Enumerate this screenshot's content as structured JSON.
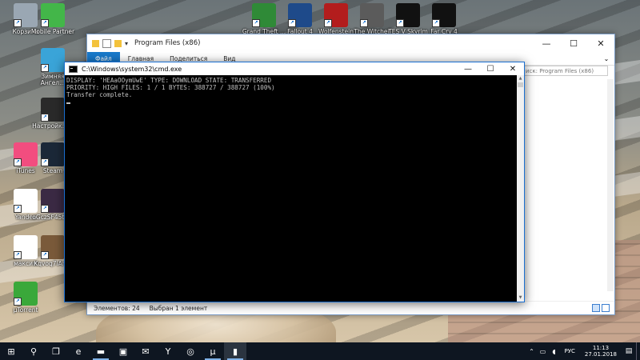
{
  "desktop": {
    "left_icons": [
      {
        "label": "Корзина",
        "icon": "recycle-bin-icon",
        "color": "#9aa7b3"
      },
      {
        "label": "Mobile Partner",
        "icon": "mobile-partner-icon",
        "color": "#43b649"
      },
      {
        "label": "Зимняя Ангел...",
        "icon": "arrow-shortcut-icon",
        "color": "#3aa4d8"
      },
      {
        "label": "Настройк... 4",
        "icon": "settings-gear-icon",
        "color": "#2a2a2a"
      },
      {
        "label": "iTunes",
        "icon": "itunes-icon",
        "color": "#f24d7f"
      },
      {
        "label": "Steam",
        "icon": "steam-icon",
        "color": "#1b2838"
      },
      {
        "label": "Yandex",
        "icon": "yandex-icon",
        "color": "#ffffff"
      },
      {
        "label": "oGczSF45tV...",
        "icon": "photo-thumbnail-icon",
        "color": "#3b2a44"
      },
      {
        "label": "максим",
        "icon": "document-icon",
        "color": "#ffffff"
      },
      {
        "label": "Kqvoq7iAn...",
        "icon": "photo-thumbnail-icon",
        "color": "#7a5a3a"
      },
      {
        "label": "µTorrent",
        "icon": "utorrent-icon",
        "color": "#3aa83a"
      }
    ],
    "top_icons": [
      {
        "label": "Grand Theft ...",
        "icon": "gta5-icon",
        "color": "#2f8a37"
      },
      {
        "label": "Fallout 4",
        "icon": "fallout4-vaultboy-icon",
        "color": "#1e4a8a"
      },
      {
        "label": "Wolfenstein",
        "icon": "wolfenstein-icon",
        "color": "#b31d1d"
      },
      {
        "label": "The Witcher",
        "icon": "witcher-medallion-icon",
        "color": "#5b5b5b"
      },
      {
        "label": "TES V Skyrim",
        "icon": "skyrim-dragon-icon",
        "color": "#111111"
      },
      {
        "label": "Far Cry 4",
        "icon": "farcry4-icon",
        "color": "#111111"
      }
    ]
  },
  "explorer": {
    "title": "Program Files (x86)",
    "tabs": [
      "Файл",
      "Главная",
      "Поделиться",
      "Вид"
    ],
    "search_placeholder": "иск: Program Files (x86)",
    "status_items": "Элементов: 24",
    "status_selected": "Выбран 1 элемент"
  },
  "cmd": {
    "title": "C:\\Windows\\system32\\cmd.exe",
    "lines": [
      "DISPLAY: 'HEAaOOymUwE' TYPE: DOWNLOAD STATE: TRANSFERRED",
      "PRIORITY: HIGH FILES: 1 / 1 BYTES: 388727 / 388727 (100%)",
      "Transfer complete."
    ]
  },
  "taskbar": {
    "buttons": [
      {
        "name": "start-button",
        "icon": "windows-logo-icon",
        "glyph": "⊞"
      },
      {
        "name": "search-button",
        "icon": "search-icon",
        "glyph": "⚲"
      },
      {
        "name": "task-view-button",
        "icon": "task-view-icon",
        "glyph": "❐"
      },
      {
        "name": "edge-button",
        "icon": "edge-icon",
        "glyph": "e"
      },
      {
        "name": "file-explorer-button",
        "icon": "folder-icon",
        "glyph": "▬"
      },
      {
        "name": "store-button",
        "icon": "store-icon",
        "glyph": "▣"
      },
      {
        "name": "mail-button",
        "icon": "mail-icon",
        "glyph": "✉"
      },
      {
        "name": "yandex-button",
        "icon": "yandex-icon",
        "glyph": "Y"
      },
      {
        "name": "steam-button",
        "icon": "steam-icon",
        "glyph": "◎"
      },
      {
        "name": "utorrent-button",
        "icon": "utorrent-icon",
        "glyph": "µ"
      },
      {
        "name": "cmd-button",
        "icon": "console-icon",
        "glyph": "▮"
      }
    ],
    "language": "РУС",
    "time": "11:13",
    "date": "27.01.2018"
  },
  "colors": {
    "accent": "#1979ca",
    "taskbar": "#0e1621",
    "console_text": "#c0c0c0"
  }
}
